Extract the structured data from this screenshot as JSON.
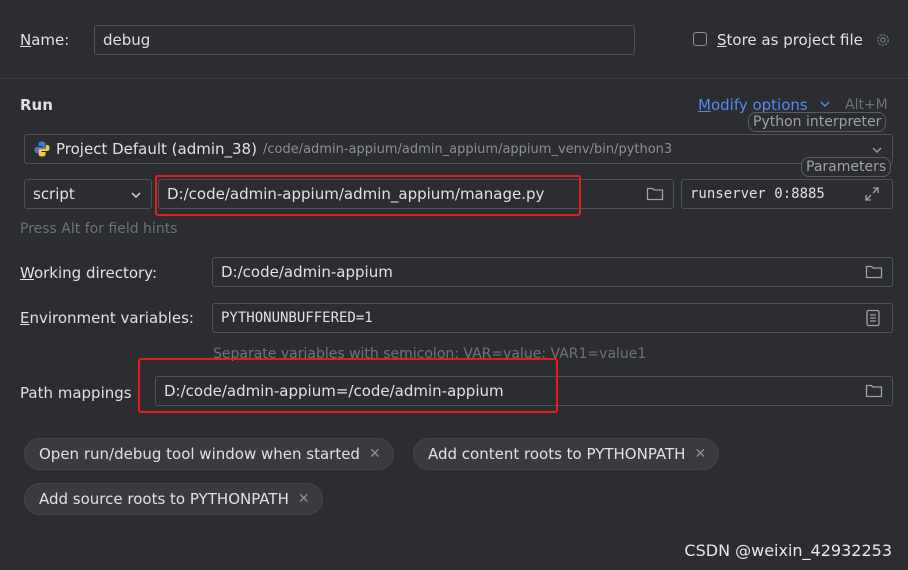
{
  "name_row": {
    "label_mnemonic": "N",
    "label_rest": "ame:",
    "value": "debug",
    "store_checked": false,
    "store_mnemonic": "S",
    "store_rest": "tore as project file"
  },
  "run_section": {
    "title": "Run",
    "modify_mnemonic": "M",
    "modify_rest": "odify options",
    "modify_shortcut": "Alt+M",
    "tooltip_interpreter": "Python interpreter",
    "tooltip_parameters": "Parameters",
    "interpreter_name": "Project Default (admin_38)",
    "interpreter_path": "/code/admin-appium/admin_appium/appium_venv/bin/python3",
    "script_type": "script",
    "script_path": "D:/code/admin-appium/admin_appium/manage.py",
    "parameters": "runserver 0:8885",
    "field_hints": "Press Alt for field hints"
  },
  "working_dir": {
    "label_mnemonic": "W",
    "label_rest": "orking directory:",
    "value": "D:/code/admin-appium"
  },
  "env_vars": {
    "label_mnemonic": "E",
    "label_rest": "nvironment variables:",
    "value": "PYTHONUNBUFFERED=1",
    "hint": "Separate variables with semicolon: VAR=value; VAR1=value1"
  },
  "path_mappings": {
    "label": "Path mappings",
    "value": "D:/code/admin-appium=/code/admin-appium"
  },
  "options": [
    "Open run/debug tool window when started",
    "Add content roots to PYTHONPATH",
    "Add source roots to PYTHONPATH"
  ],
  "watermark": "CSDN @weixin_42932253",
  "colors": {
    "background": "#2b2d30",
    "accent_link": "#548af7",
    "annotation_red": "#e0201c"
  }
}
